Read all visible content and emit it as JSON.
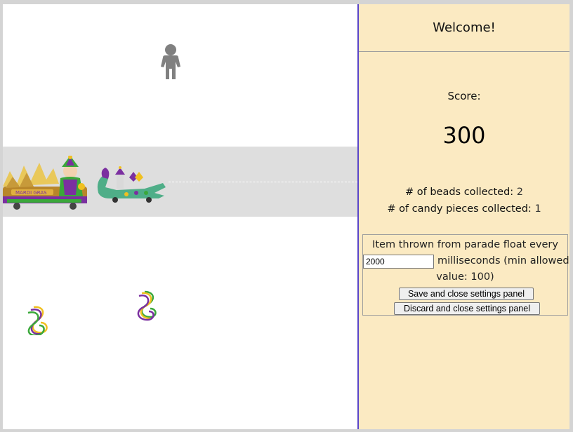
{
  "panel": {
    "welcome": "Welcome!",
    "score_label": "Score:",
    "score_value": "300",
    "beads_label": "# of beads collected:",
    "beads_value": "2",
    "candy_label": "# of candy pieces collected:",
    "candy_value": "1"
  },
  "settings": {
    "line1": "Item thrown from parade float every",
    "interval_value": "2000",
    "line2": "milliseconds (min allowed",
    "line3": "value: 100)",
    "save_label": "Save and close settings panel",
    "discard_label": "Discard and close settings panel"
  },
  "colors": {
    "panel_bg": "#fbeac2",
    "divider": "#5a46c8",
    "road": "#dedede",
    "mardi_gras_purple": "#7b2fa0",
    "mardi_gras_green": "#3aa83a",
    "mardi_gras_gold": "#f0c020"
  },
  "game": {
    "player_icon": "person-icon",
    "float_icons": [
      "parade-float-king-icon",
      "parade-float-gator-icon"
    ],
    "item_icons": [
      "beads-icon",
      "beads-icon"
    ]
  }
}
